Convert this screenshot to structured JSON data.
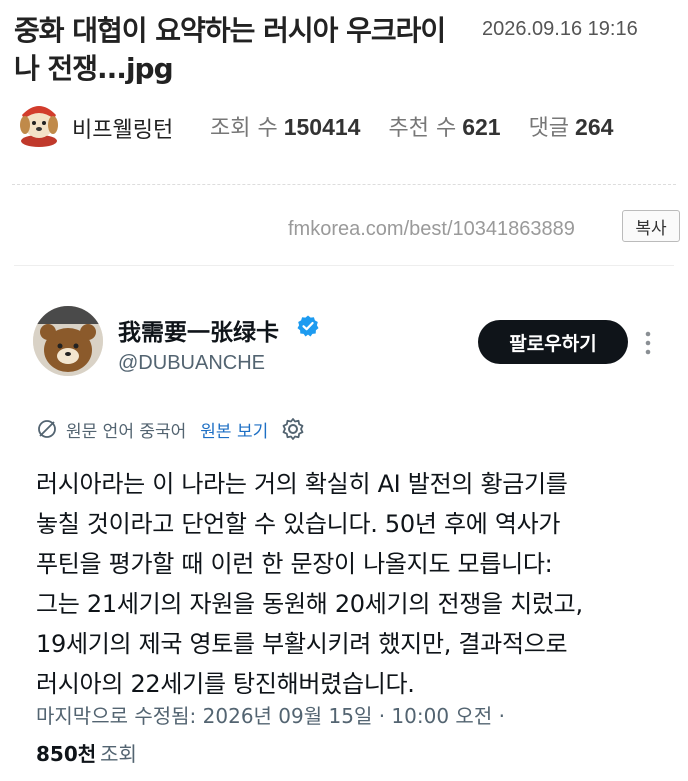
{
  "post": {
    "title": "중화 대협이 요약하는 러시아 우크라이나 전쟁...jpg",
    "datetime": "2026.09.16 19:16",
    "author": "비프웰링턴",
    "stats": [
      {
        "label": "조회 수",
        "value": "150414"
      },
      {
        "label": "추천 수",
        "value": "621"
      },
      {
        "label": "댓글",
        "value": "264"
      }
    ],
    "source_url": "fmkorea.com/best/10341863889",
    "copy_label": "복사"
  },
  "tweet": {
    "display_name": "我需要一张绿卡",
    "handle": "@DUBUANCHE",
    "follow_label": "팔로우하기",
    "translate_info": "원문 언어 중국어",
    "translate_link": "원본 보기",
    "body_lines": [
      "러시아라는 이 나라는 거의 확실히 AI 발전의 황금기를",
      "놓칠 것이라고 단언할 수 있습니다. 50년 후에 역사가",
      "푸틴을 평가할 때 이런 한 문장이 나올지도 모릅니다:",
      "그는 21세기의 자원을 동원해 20세기의 전쟁을 치렀고,",
      "19세기의 제국 영토를 부활시키려 했지만, 결과적으로",
      "러시아의 22세기를 탕진해버렸습니다."
    ],
    "meta": "마지막으로 수정됨: 2026년 09월 15일 · 10:00 오전 ·",
    "views_count": "850천",
    "views_label": "조회"
  },
  "colors": {
    "verified_badge": "#1d9bf0",
    "follow_button": "#0f1419",
    "link": "#1d6fc4"
  },
  "icons": [
    "dog-avatar-icon",
    "verified-badge-icon",
    "more-vertical-icon",
    "translate-icon",
    "gear-icon"
  ]
}
